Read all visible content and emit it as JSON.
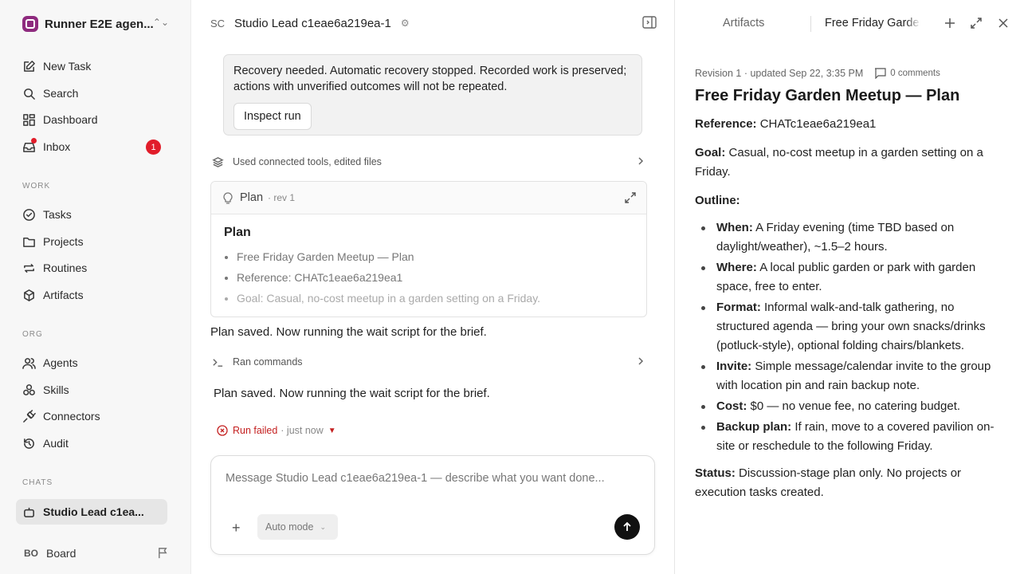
{
  "workspace": {
    "name": "Runner E2E agen..."
  },
  "sidebar": {
    "nav": [
      {
        "label": "New Task"
      },
      {
        "label": "Search"
      },
      {
        "label": "Dashboard"
      },
      {
        "label": "Inbox",
        "badge": "1"
      }
    ],
    "work_section": "WORK",
    "work": [
      {
        "label": "Tasks"
      },
      {
        "label": "Projects"
      },
      {
        "label": "Routines"
      },
      {
        "label": "Artifacts"
      }
    ],
    "org_section": "ORG",
    "org": [
      {
        "label": "Agents"
      },
      {
        "label": "Skills"
      },
      {
        "label": "Connectors"
      },
      {
        "label": "Audit"
      }
    ],
    "chats_section": "CHATS",
    "chat_item": "Studio Lead c1ea...",
    "board": {
      "initials": "BO",
      "label": "Board"
    }
  },
  "main": {
    "agent_initials": "SC",
    "agent_title": "Studio Lead c1eae6a219ea-1",
    "recovery_text": "Recovery needed. Automatic recovery stopped. Recorded work is preserved; actions with unverified outcomes will not be repeated.",
    "inspect_label": "Inspect run",
    "tools_line": "Used connected tools, edited files",
    "plan_card": {
      "label": "Plan",
      "rev": "· rev 1",
      "heading": "Plan",
      "items": [
        "Free Friday Garden Meetup — Plan",
        "Reference: CHATc1eae6a219ea1",
        "Goal: Casual, no-cost meetup in a garden setting on a Friday."
      ]
    },
    "message_1": "Plan saved. Now running the wait script for the brief.",
    "commands_line": "Ran commands",
    "message_2": "Plan saved. Now running the wait script for the brief.",
    "run_status": "Run failed",
    "run_time": "· just now",
    "composer": {
      "placeholder": "Message Studio Lead c1eae6a219ea-1 — describe what you want done...",
      "mode": "Auto mode"
    }
  },
  "panel": {
    "tab_artifacts": "Artifacts",
    "tab_active": "Free Friday Garden Meetup — Plan",
    "meta": "Revision 1 · updated Sep 22, 3:35 PM",
    "comments": "0 comments",
    "title": "Free Friday Garden Meetup — Plan",
    "reference_label": "Reference:",
    "reference_value": "CHATc1eae6a219ea1",
    "goal_label": "Goal:",
    "goal_value": "Casual, no-cost meetup in a garden setting on a Friday.",
    "outline_label": "Outline:",
    "outline": [
      {
        "label": "When:",
        "text": "A Friday evening (time TBD based on daylight/weather), ~1.5–2 hours."
      },
      {
        "label": "Where:",
        "text": "A local public garden or park with garden space, free to enter."
      },
      {
        "label": "Format:",
        "text": "Informal walk-and-talk gathering, no structured agenda — bring your own snacks/drinks (potluck-style), optional folding chairs/blankets."
      },
      {
        "label": "Invite:",
        "text": "Simple message/calendar invite to the group with location pin and rain backup note."
      },
      {
        "label": "Cost:",
        "text": "$0 — no venue fee, no catering budget."
      },
      {
        "label": "Backup plan:",
        "text": "If rain, move to a covered pavilion on-site or reschedule to the following Friday."
      }
    ],
    "status_label": "Status:",
    "status_value": "Discussion-stage plan only. No projects or execution tasks created."
  },
  "colors": {
    "accent_red": "#e11d2a",
    "workspace_logo": "#8e2a7e",
    "send_button": "#111111"
  }
}
